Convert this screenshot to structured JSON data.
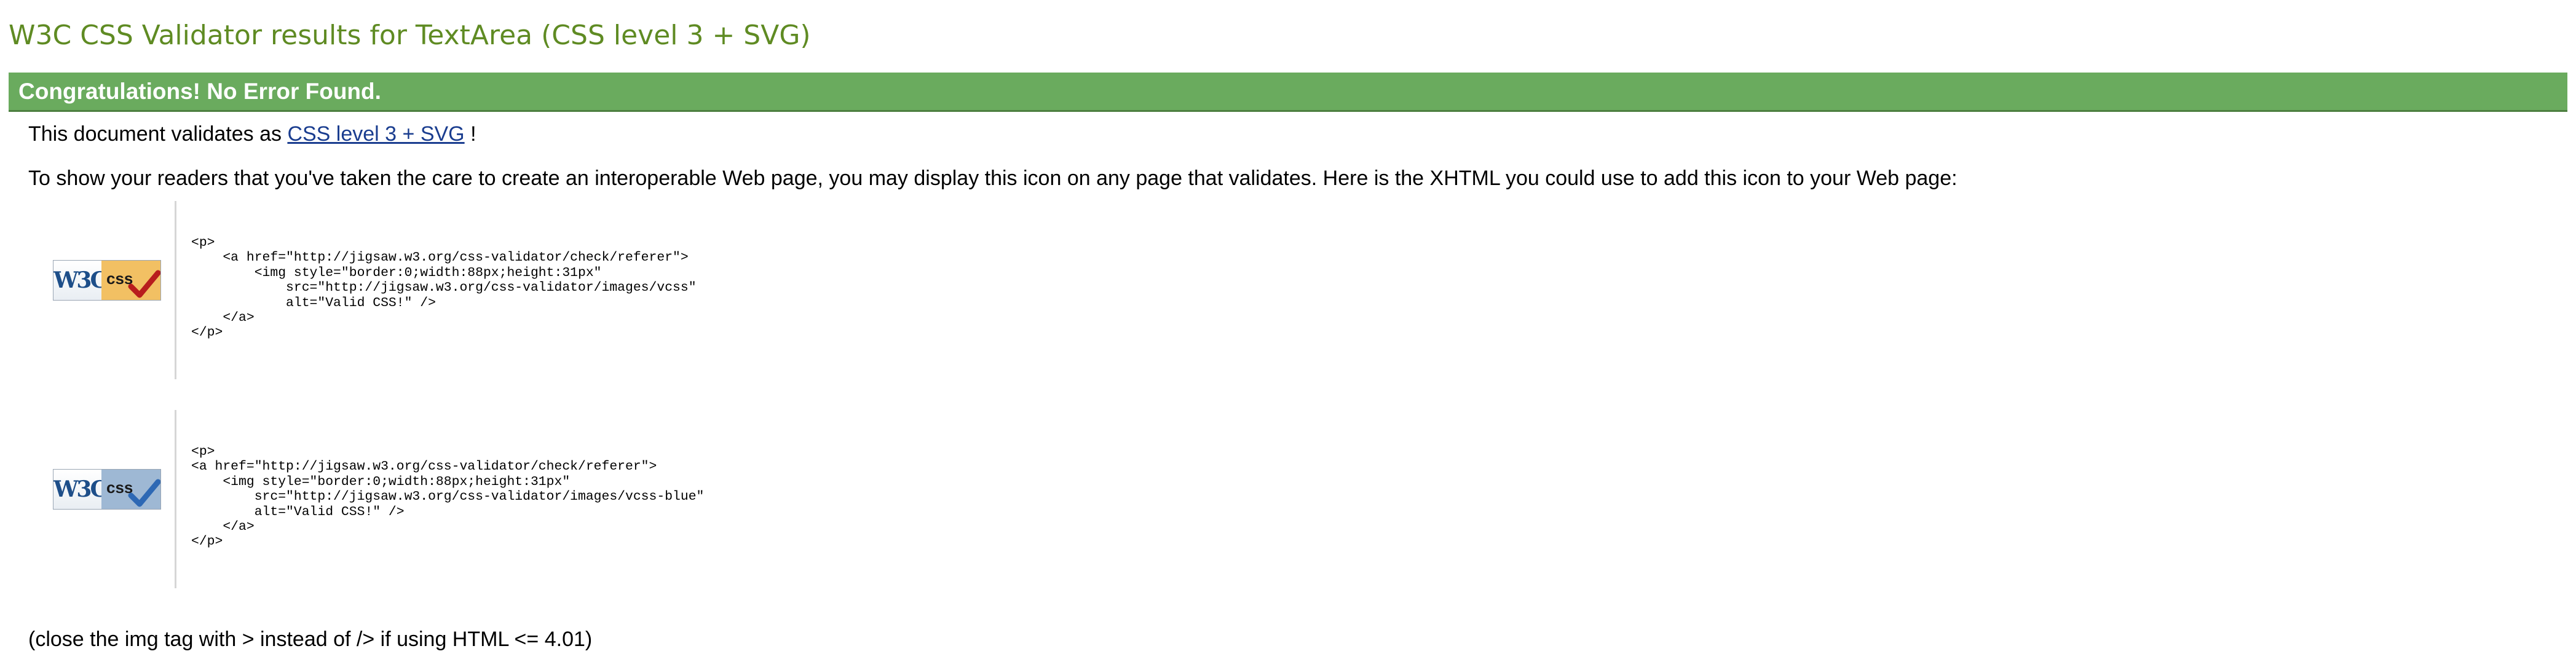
{
  "page": {
    "title": "W3C CSS Validator results for TextArea (CSS level 3 + SVG)"
  },
  "result": {
    "congrats": "Congratulations! No Error Found.",
    "validates_prefix": "This document validates as",
    "validates_link": "CSS level 3 + SVG",
    "validates_suffix": " !"
  },
  "instructions": {
    "text": "To show your readers that you've taken the care to create an interoperable Web page, you may display this icon on any page that validates. Here is the XHTML you could use to add this icon to your Web page:"
  },
  "badges": [
    {
      "icon": "w3c-css-valid-gold-icon",
      "w3c_text": "W3C",
      "css_text": "css",
      "check_color": "#b81d1d",
      "code": "<p>\n    <a href=\"http://jigsaw.w3.org/css-validator/check/referer\">\n        <img style=\"border:0;width:88px;height:31px\"\n            src=\"http://jigsaw.w3.org/css-validator/images/vcss\"\n            alt=\"Valid CSS!\" />\n    </a>\n</p>"
    },
    {
      "icon": "w3c-css-valid-blue-icon",
      "w3c_text": "W3C",
      "css_text": "css",
      "check_color": "#2d68b4",
      "code": "<p>\n<a href=\"http://jigsaw.w3.org/css-validator/check/referer\">\n    <img style=\"border:0;width:88px;height:31px\"\n        src=\"http://jigsaw.w3.org/css-validator/images/vcss-blue\"\n        alt=\"Valid CSS!\" />\n    </a>\n</p>"
    }
  ],
  "footer": {
    "close_note": "(close the img tag with > instead of /> if using HTML <= 4.01)"
  },
  "colors": {
    "title_green": "#5f8b23",
    "banner_green": "#6aab5e",
    "link_blue": "#1a3d8f"
  }
}
